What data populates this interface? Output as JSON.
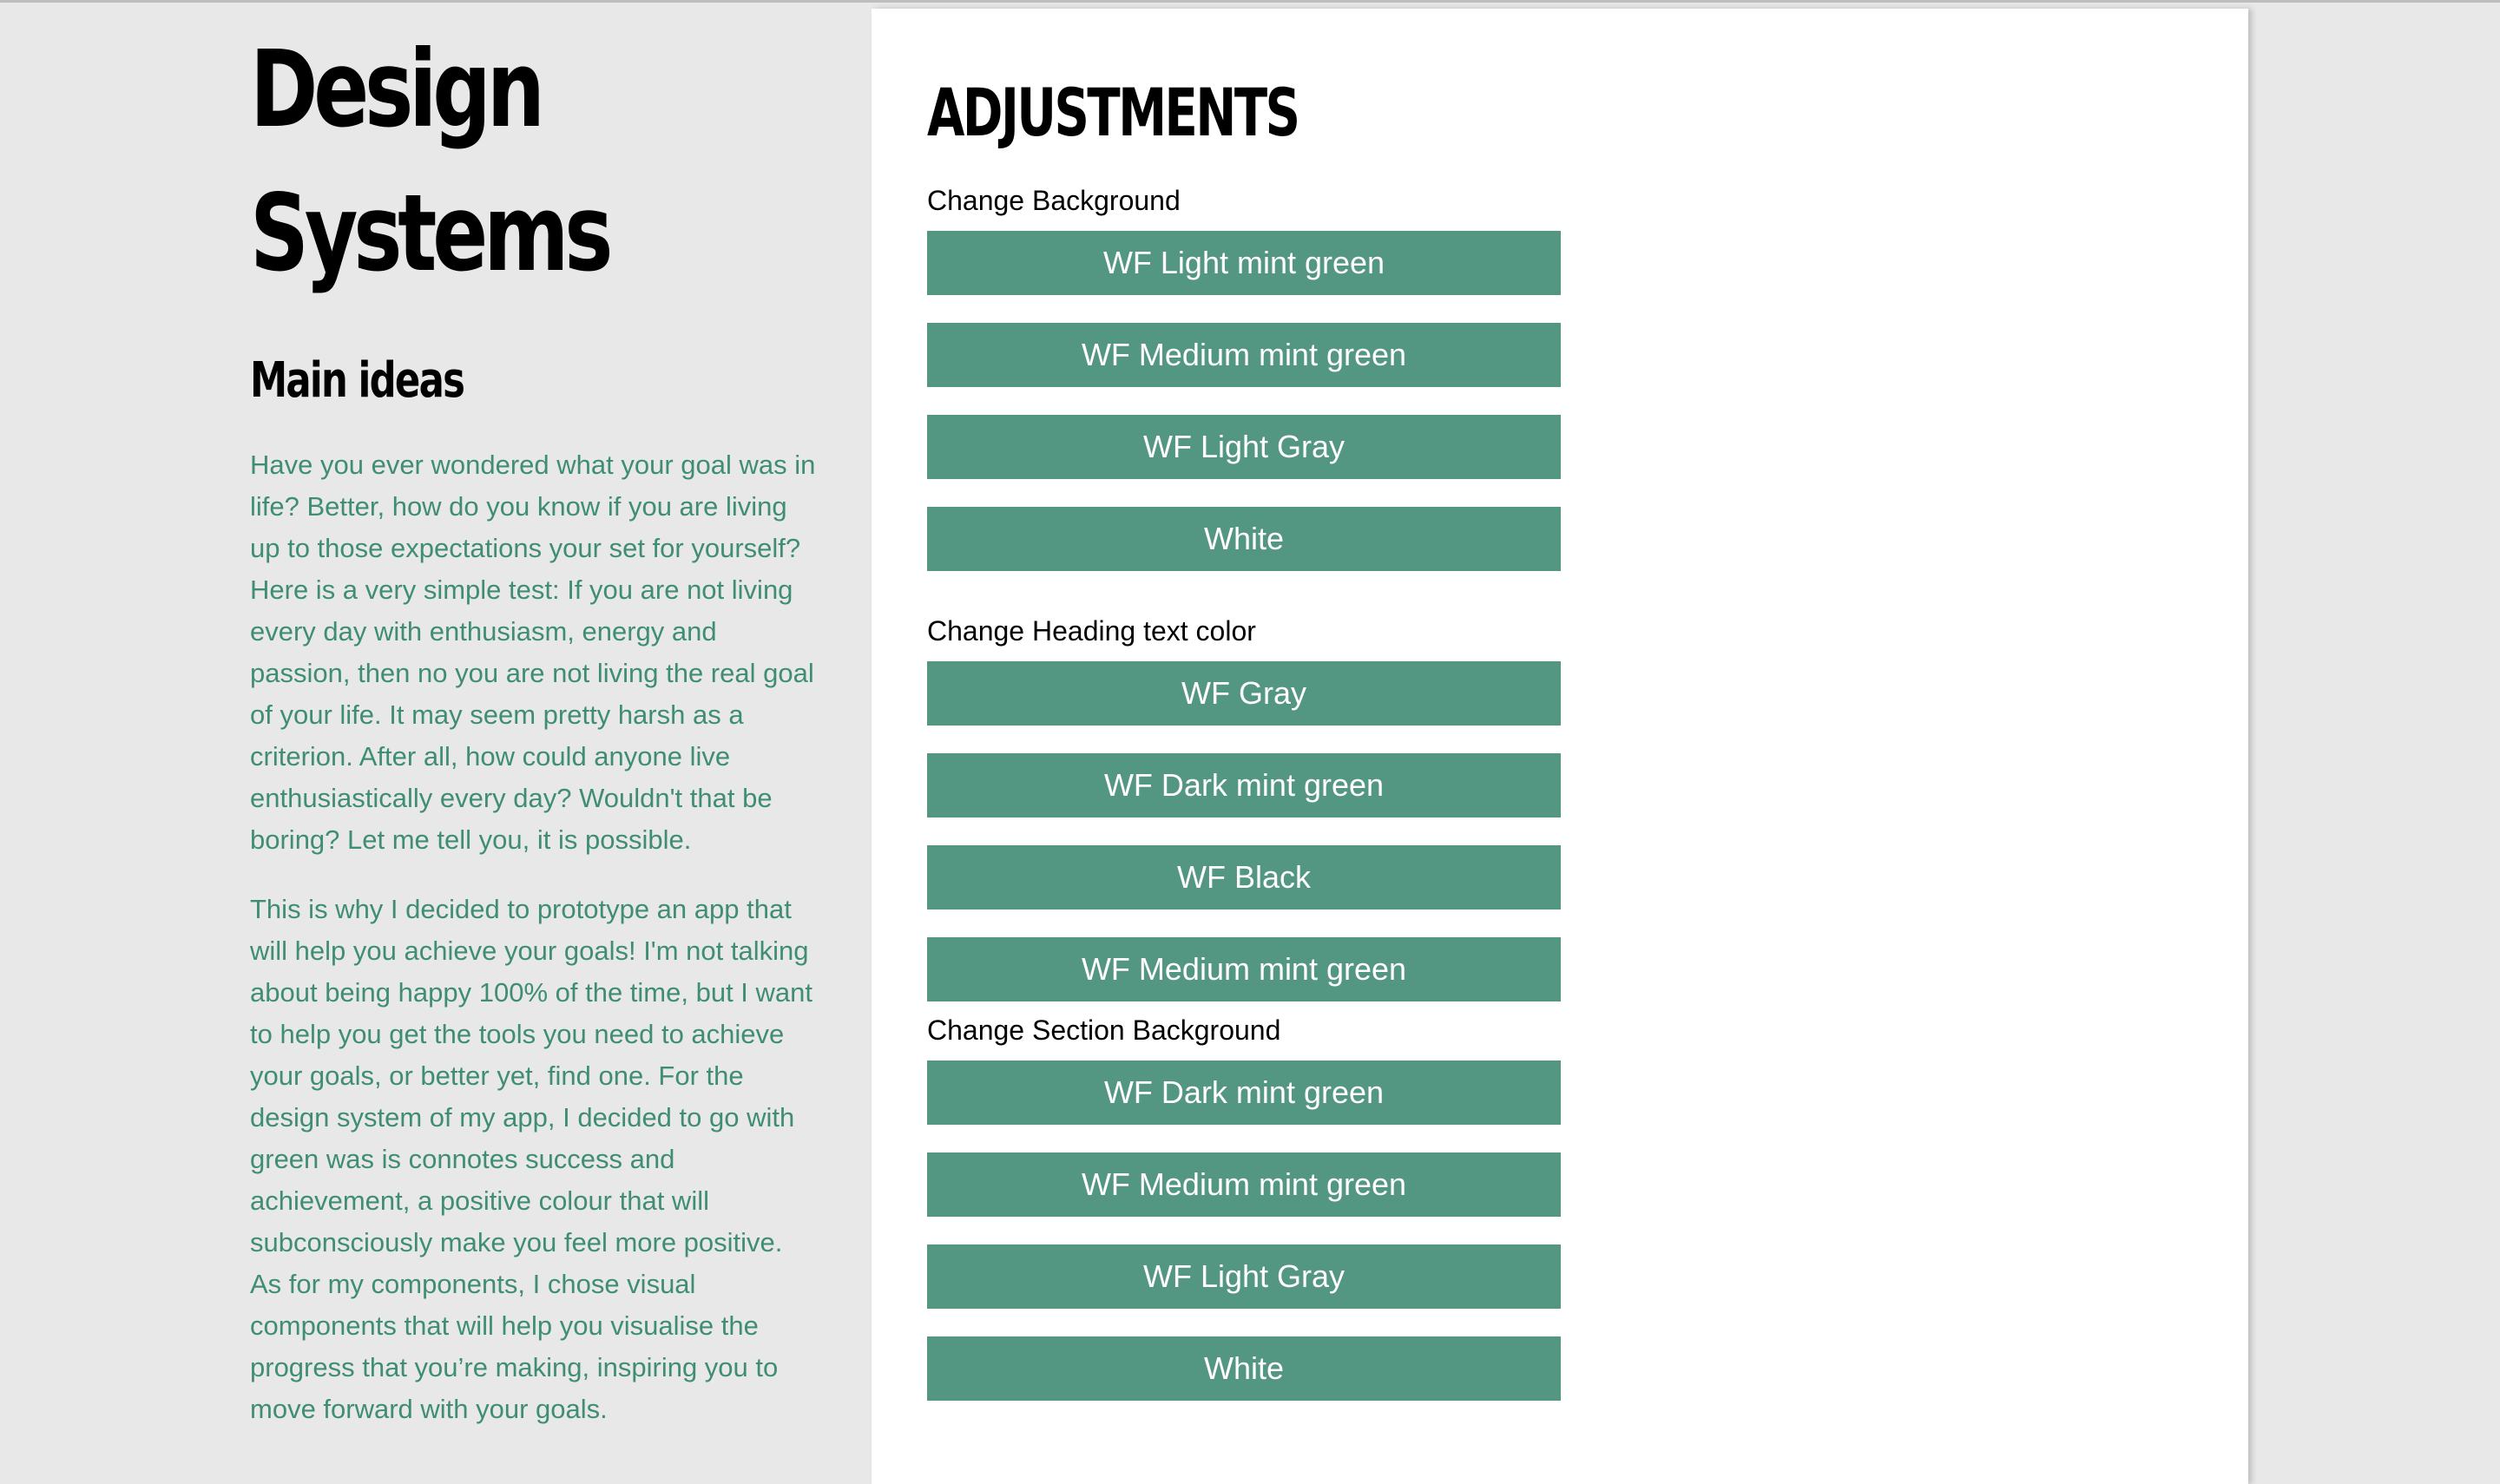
{
  "page": {
    "title": "Design Systems",
    "title_line1": "Design",
    "title_line2": "Systems",
    "subtitle": "Main ideas",
    "paragraphs": [
      "Have you ever wondered what your goal was in life? Better, how do you know if you are living up to those expectations your set for yourself? Here is a very simple test: If you are not living every day with enthusiasm, energy and passion, then no you are not living the real goal of your life. It may seem pretty harsh as a criterion. After all, how could anyone live enthusiastically every day? Wouldn't that be boring? Let me tell you, it is possible.",
      "This is why I decided to prototype an app that will help you achieve your goals! I'm not talking about being happy 100% of the time, but I want to help you get the tools you need to achieve your goals, or better yet, find one. For the design system of my app, I decided to go with green was is connotes success and achievement, a positive colour that will subconsciously make you feel more positive. As for my components, I chose visual components that will help you visualise the progress that you’re making, inspiring you to move forward with your goals."
    ]
  },
  "adjustments": {
    "title": "ADJUSTMENTS",
    "groups": [
      {
        "label": "Change Background",
        "buttons": [
          "WF Light mint green",
          "WF Medium mint green",
          "WF Light Gray",
          "White"
        ]
      },
      {
        "label": "Change Heading text color",
        "buttons": [
          "WF Gray",
          "WF Dark mint green",
          "WF Black",
          "WF Medium mint green"
        ]
      },
      {
        "label": "Change Section Background",
        "buttons": [
          "WF Dark mint green",
          "WF Medium mint green",
          "WF Light Gray",
          "White"
        ]
      }
    ]
  },
  "colors": {
    "page_background": "#e8e8e8",
    "body_text": "#3f8e73",
    "button_background": "#539681",
    "button_text": "#ffffff"
  }
}
